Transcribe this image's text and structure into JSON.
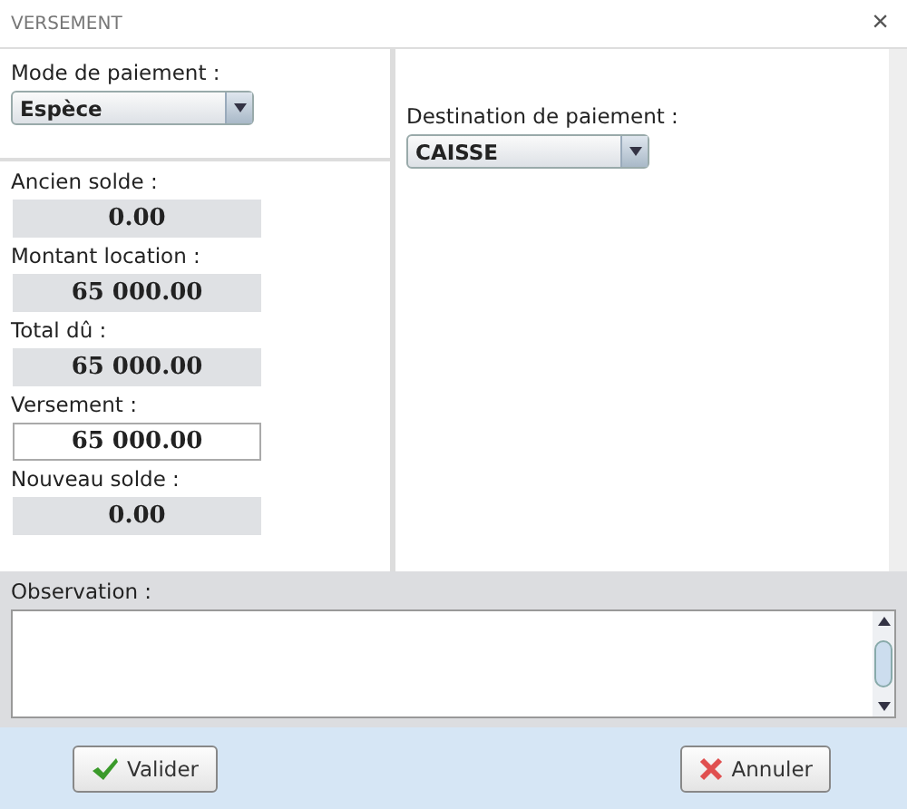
{
  "window": {
    "title": "VERSEMENT",
    "close": "×"
  },
  "payment_mode": {
    "label": "Mode de paiement :",
    "value": "Espèce"
  },
  "amounts": [
    {
      "label": "Ancien solde :",
      "value": "0.00",
      "editable": false
    },
    {
      "label": "Montant location :",
      "value": "65 000.00",
      "editable": false
    },
    {
      "label": "Total dû :",
      "value": "65 000.00",
      "editable": false
    },
    {
      "label": "Versement :",
      "value": "65 000.00",
      "editable": true
    },
    {
      "label": "Nouveau solde :",
      "value": "0.00",
      "editable": false
    }
  ],
  "destination": {
    "label": "Destination de paiement :",
    "value": "CAISSE"
  },
  "observation": {
    "label": "Observation :"
  },
  "buttons": [
    {
      "kind": "ok",
      "label": "Valider"
    },
    {
      "kind": "cancel",
      "label": "Annuler"
    }
  ]
}
